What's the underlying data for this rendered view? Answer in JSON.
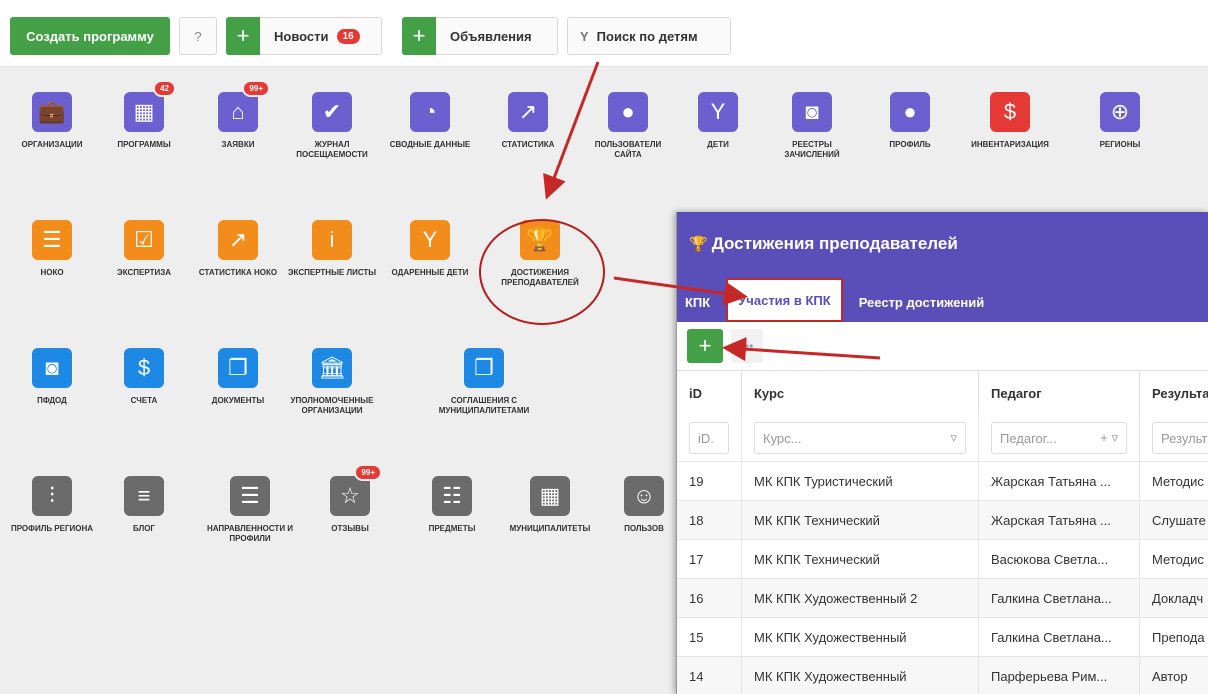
{
  "toolbar": {
    "create_label": "Создать программу",
    "help_icon": "?",
    "news_label": "Новости",
    "news_badge": "16",
    "ads_label": "Объявления",
    "search_label": "Поиск по детям",
    "plus": "+"
  },
  "tiles": [
    {
      "label": "ОРГАНИЗАЦИИ",
      "icon": "briefcase-icon",
      "glyph": "💼"
    },
    {
      "label": "ПРОГРАММЫ",
      "icon": "calendar-icon",
      "glyph": "▦",
      "badge": "42"
    },
    {
      "label": "ЗАЯВКИ",
      "icon": "basket-icon",
      "glyph": "⌂",
      "badge": "99+"
    },
    {
      "label": "ЖУРНАЛ ПОСЕЩАЕМОСТИ",
      "icon": "calendar-check-icon",
      "glyph": "✔"
    },
    {
      "label": "СВОДНЫЕ ДАННЫЕ",
      "icon": "gauge-icon",
      "glyph": "◔"
    },
    {
      "label": "СТАТИСТИКА",
      "icon": "chart-icon",
      "glyph": "↗"
    },
    {
      "label": "ПОЛЬЗОВАТЕЛИ САЙТА",
      "icon": "user-icon",
      "glyph": "●"
    },
    {
      "label": "ДЕТИ",
      "icon": "child-icon",
      "glyph": "Y"
    },
    {
      "label": "РЕЕСТРЫ ЗАЧИСЛЕНИЙ",
      "icon": "document-icon",
      "glyph": "◙"
    },
    {
      "label": "ПРОФИЛЬ",
      "icon": "user-icon",
      "glyph": "●"
    },
    {
      "label": "ИНВЕНТАРИЗАЦИЯ",
      "icon": "money-icon",
      "glyph": "$"
    },
    {
      "label": "РЕГИОНЫ",
      "icon": "globe-icon",
      "glyph": "⊕"
    },
    {
      "label": "НОКО",
      "icon": "list-icon",
      "glyph": "☰"
    },
    {
      "label": "ЭКСПЕРТИЗА",
      "icon": "clipboard-icon",
      "glyph": "☑"
    },
    {
      "label": "СТАТИСТИКА НОКО",
      "icon": "chart-icon",
      "glyph": "↗"
    },
    {
      "label": "ЭКСПЕРТНЫЕ ЛИСТЫ",
      "icon": "info-icon",
      "glyph": "i"
    },
    {
      "label": "ОДАРЕННЫЕ ДЕТИ",
      "icon": "child-icon",
      "glyph": "Y"
    },
    {
      "label": "ДОСТИЖЕНИЯ ПРЕПОДАВАТЕЛЕЙ",
      "icon": "trophy-icon",
      "glyph": "🏆"
    },
    {
      "label": "ПФДОД",
      "icon": "document-icon",
      "glyph": "◙"
    },
    {
      "label": "СЧЕТА",
      "icon": "invoice-icon",
      "glyph": "$"
    },
    {
      "label": "ДОКУМЕНТЫ",
      "icon": "copy-icon",
      "glyph": "❐"
    },
    {
      "label": "УПОЛНОМОЧЕННЫЕ ОРГАНИЗАЦИИ",
      "icon": "bank-icon",
      "glyph": "🏛"
    },
    {
      "label": "СОГЛАШЕНИЯ С МУНИЦИПАЛИТЕТАМИ",
      "icon": "copy-icon",
      "glyph": "❐"
    },
    {
      "label": "ПРОФИЛЬ РЕГИОНА",
      "icon": "sliders-icon",
      "glyph": "⫶"
    },
    {
      "label": "БЛОГ",
      "icon": "file-icon",
      "glyph": "≡"
    },
    {
      "label": "НАПРАВЛЕННОСТИ И ПРОФИЛИ",
      "icon": "menu-icon",
      "glyph": "☰"
    },
    {
      "label": "ОТЗЫВЫ",
      "icon": "star-icon",
      "glyph": "☆",
      "badge": "99+"
    },
    {
      "label": "ПРЕДМЕТЫ",
      "icon": "list-icon",
      "glyph": "☷"
    },
    {
      "label": "МУНИЦИПАЛИТЕТЫ",
      "icon": "building-icon",
      "glyph": "▦"
    },
    {
      "label": "ПОЛЬЗОВ",
      "icon": "users-icon",
      "glyph": "☺"
    }
  ],
  "panel": {
    "title": "Достижения преподавателей",
    "trophy": "🏆",
    "tabs": [
      "КПК",
      "Участия в КПК",
      "Реестр достижений"
    ],
    "add": "+",
    "more": "•••",
    "columns": [
      "iD",
      "Курс",
      "Педагог",
      "Результа"
    ],
    "filters": [
      "iD.",
      "Курс...",
      "Педагог...",
      "Результ"
    ],
    "rows": [
      {
        "id": "19",
        "course": "МК КПК Туристический",
        "teacher": "Жарская Татьяна ...",
        "result": "Методис"
      },
      {
        "id": "18",
        "course": "МК КПК Технический",
        "teacher": "Жарская Татьяна ...",
        "result": "Слушате"
      },
      {
        "id": "17",
        "course": "МК КПК Технический",
        "teacher": "Васюкова Светла...",
        "result": "Методис"
      },
      {
        "id": "16",
        "course": "МК КПК Художественный 2",
        "teacher": "Галкина Светлана...",
        "result": "Докладч"
      },
      {
        "id": "15",
        "course": "МК КПК Художественный",
        "teacher": "Галкина Светлана...",
        "result": "Препода"
      },
      {
        "id": "14",
        "course": "МК КПК Художественный",
        "teacher": "Парферьева Рим...",
        "result": "Автор"
      }
    ]
  }
}
